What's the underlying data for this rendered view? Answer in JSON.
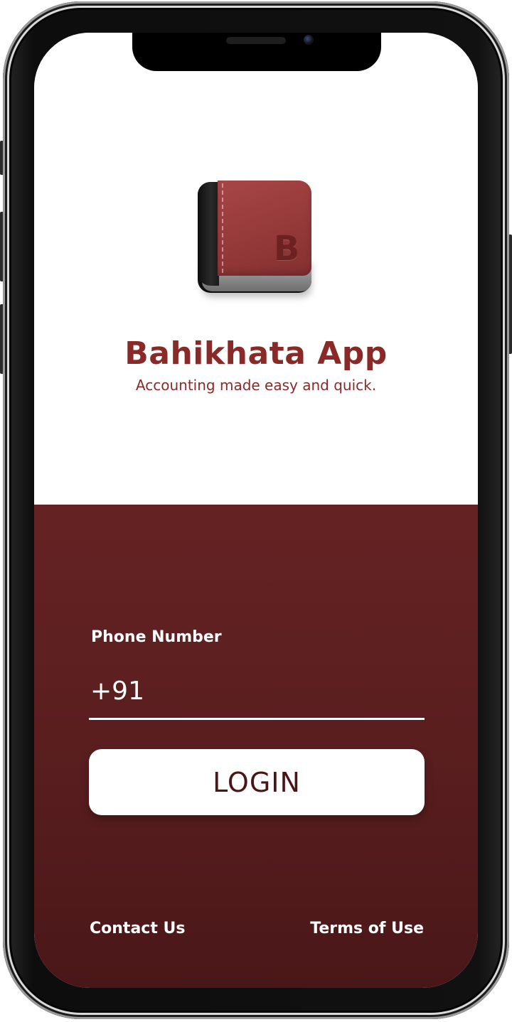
{
  "app": {
    "title": "Bahikhata App",
    "subtitle": "Accounting made easy and quick.",
    "icon_letter": "B",
    "icon_name": "ledger-book-icon"
  },
  "login_form": {
    "phone_label": "Phone Number",
    "phone_prefix": "+91",
    "phone_value": "",
    "login_label": "LOGIN"
  },
  "footer": {
    "contact_label": "Contact Us",
    "terms_label": "Terms of Use"
  },
  "colors": {
    "brand": "#8a2a28",
    "panel": "#5a1e1f",
    "button_text": "#4a1516",
    "background": "#ffffff"
  }
}
